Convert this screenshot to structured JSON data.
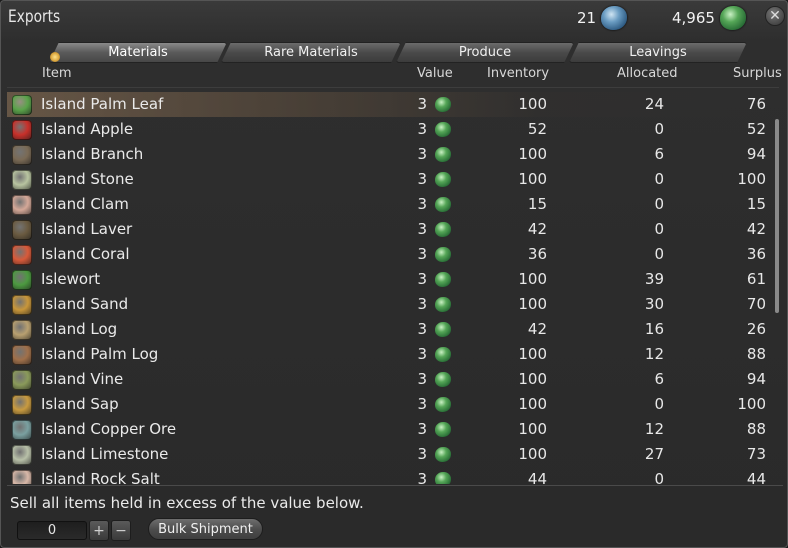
{
  "window": {
    "title": "Exports"
  },
  "currencies": [
    {
      "amount": "21",
      "icon": "blue-seal-icon",
      "color": "#4a7fae"
    },
    {
      "amount": "4,965",
      "icon": "green-seal-icon",
      "color": "#3f8f48"
    }
  ],
  "tabs": [
    {
      "label": "Materials",
      "active": true
    },
    {
      "label": "Rare Materials",
      "active": false
    },
    {
      "label": "Produce",
      "active": false
    },
    {
      "label": "Leavings",
      "active": false
    }
  ],
  "columns": {
    "item": "Item",
    "value": "Value",
    "inventory": "Inventory",
    "allocated": "Allocated",
    "surplus": "Surplus"
  },
  "items": [
    {
      "name": "Island Palm Leaf",
      "value": "3",
      "inventory": "100",
      "allocated": "24",
      "surplus": "76",
      "icon": "palm-leaf-icon",
      "color": "#5aa34a",
      "selected": true
    },
    {
      "name": "Island Apple",
      "value": "3",
      "inventory": "52",
      "allocated": "0",
      "surplus": "52",
      "icon": "apple-icon",
      "color": "#c8302a"
    },
    {
      "name": "Island Branch",
      "value": "3",
      "inventory": "100",
      "allocated": "6",
      "surplus": "94",
      "icon": "branch-icon",
      "color": "#7a6a55"
    },
    {
      "name": "Island Stone",
      "value": "3",
      "inventory": "100",
      "allocated": "0",
      "surplus": "100",
      "icon": "stone-icon",
      "color": "#b8c4a0"
    },
    {
      "name": "Island Clam",
      "value": "3",
      "inventory": "15",
      "allocated": "0",
      "surplus": "15",
      "icon": "clam-icon",
      "color": "#d4a898"
    },
    {
      "name": "Island Laver",
      "value": "3",
      "inventory": "42",
      "allocated": "0",
      "surplus": "42",
      "icon": "laver-icon",
      "color": "#6a5a40"
    },
    {
      "name": "Island Coral",
      "value": "3",
      "inventory": "36",
      "allocated": "0",
      "surplus": "36",
      "icon": "coral-icon",
      "color": "#d85a3a"
    },
    {
      "name": "Islewort",
      "value": "3",
      "inventory": "100",
      "allocated": "39",
      "surplus": "61",
      "icon": "islewort-icon",
      "color": "#4c9a40"
    },
    {
      "name": "Island Sand",
      "value": "3",
      "inventory": "100",
      "allocated": "30",
      "surplus": "70",
      "icon": "sand-icon",
      "color": "#c8963a"
    },
    {
      "name": "Island Log",
      "value": "3",
      "inventory": "42",
      "allocated": "16",
      "surplus": "26",
      "icon": "log-icon",
      "color": "#b8a070"
    },
    {
      "name": "Island Palm Log",
      "value": "3",
      "inventory": "100",
      "allocated": "12",
      "surplus": "88",
      "icon": "palm-log-icon",
      "color": "#a0704a"
    },
    {
      "name": "Island Vine",
      "value": "3",
      "inventory": "100",
      "allocated": "6",
      "surplus": "94",
      "icon": "vine-icon",
      "color": "#8a9a5a"
    },
    {
      "name": "Island Sap",
      "value": "3",
      "inventory": "100",
      "allocated": "0",
      "surplus": "100",
      "icon": "sap-icon",
      "color": "#c89a40"
    },
    {
      "name": "Island Copper Ore",
      "value": "3",
      "inventory": "100",
      "allocated": "12",
      "surplus": "88",
      "icon": "copper-ore-icon",
      "color": "#7aa0a0"
    },
    {
      "name": "Island Limestone",
      "value": "3",
      "inventory": "100",
      "allocated": "27",
      "surplus": "73",
      "icon": "limestone-icon",
      "color": "#b8c0a8"
    },
    {
      "name": "Island Rock Salt",
      "value": "3",
      "inventory": "44",
      "allocated": "0",
      "surplus": "44",
      "icon": "rock-salt-icon",
      "color": "#d8b8a8"
    }
  ],
  "footer": {
    "instruction": "Sell all items held in excess of the value below.",
    "quantity": "0",
    "plus": "+",
    "minus": "−",
    "bulk_label": "Bulk Shipment"
  },
  "close_glyph": "✕"
}
